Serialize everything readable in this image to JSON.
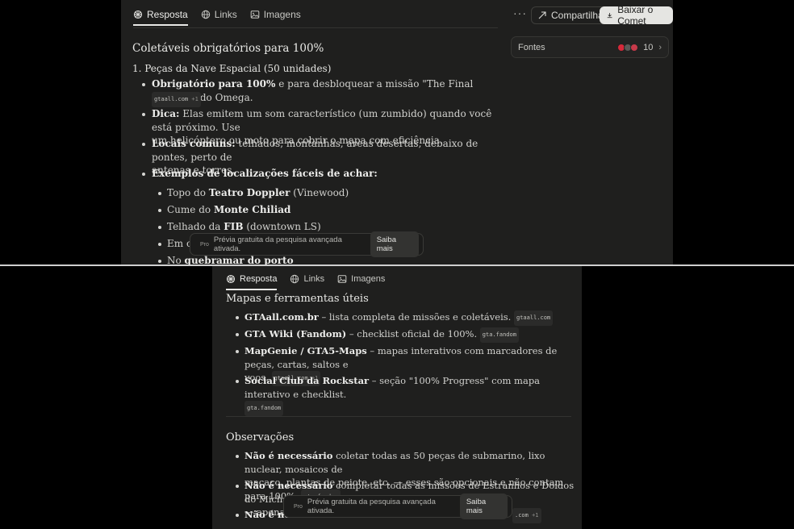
{
  "top": {
    "tabs": [
      {
        "label": "Resposta"
      },
      {
        "label": "Links"
      },
      {
        "label": "Imagens"
      }
    ],
    "menu": "···",
    "share_label": "Compartilhar",
    "download_label": "Baixar o Comet",
    "sources": {
      "label": "Fontes",
      "count": "10"
    },
    "heading": "Coletáveis obrigatórios para 100%",
    "section": "1. Peças da Nave Espacial (50 unidades)",
    "b1": {
      "strong": "Obrigatório para 100%",
      "text": " e para desbloquear a missão \"The Final Frontier\" do Omega."
    },
    "chip1": {
      "site": "gtaall.com",
      "plus": "+1"
    },
    "b2": {
      "strong": "Dica:",
      "line1": " Elas emitem um som característico (um zumbido) quando você está próximo. Use",
      "line2": "um helicóptero ou moto para cobrir o mapa com eficiência."
    },
    "b3": {
      "strong": "Locais comuns:",
      "line1": " telhados, montanhas, áreas desertas, debaixo de pontes, perto de",
      "line2": "antenas e torres."
    },
    "b4": {
      "strong": "Exemplos de localizações fáceis de achar:"
    },
    "sub1": {
      "pre": "Topo do ",
      "strong": "Teatro Doppler",
      "post": " (Vinewood)"
    },
    "sub2": {
      "pre": "Cume do ",
      "strong": "Monte Chiliad",
      "post": ""
    },
    "sub3": {
      "pre": "Telhado da ",
      "strong": "FIB",
      "post": " (downtown LS)"
    },
    "sub4": {
      "pre": "Em ci"
    },
    "sub5": {
      "pre": "No ",
      "strong": "quebramar do porto"
    },
    "toast": {
      "pro": "Pro",
      "text": "Prévia gratuita da pesquisa avançada ativada.",
      "button": "Saiba mais"
    }
  },
  "bottom": {
    "tabs": [
      {
        "label": "Resposta"
      },
      {
        "label": "Links"
      },
      {
        "label": "Imagens"
      }
    ],
    "heading": "Mapas e ferramentas úteis",
    "i1": {
      "strong": "GTAall.com.br",
      "text": " – lista completa de missões e coletáveis.",
      "chip": "gtaall.com"
    },
    "i2": {
      "strong": "GTA Wiki (Fandom)",
      "text": " – checklist oficial de 100%.",
      "chip": "gta.fandom"
    },
    "i3": {
      "strong": "MapGenie / GTA5-Maps",
      "line1": " – mapas interativos com marcadores de peças, cartas, saltos e",
      "line2": "voos.",
      "chip": "gtaall.com",
      "plus": "+1"
    },
    "i4": {
      "strong": "Social Club da Rockstar",
      "text": " – seção \"100% Progress\" com mapa interativo e checklist.",
      "chip": "gta.fandom"
    },
    "heading2": "Observações",
    "o1": {
      "strong": "Não é necessário",
      "line1": " coletar todas as 50 peças de submarino, lixo nuclear, mosaicos de",
      "line2": "macaco, plantas de peiote, etc. — esses são opcionais e não contam para 100%.",
      "chip": "gta.fandom"
    },
    "o2": {
      "strong": "Não é necessário",
      "line1": " completar todas as missões de Estranhos e Doidos do Michael e Trevor",
      "line2": "— apenas a"
    },
    "o3": {
      "strong": "Não é nece",
      "chip": ".com",
      "plus": "+1"
    },
    "toast": {
      "pro": "Pro",
      "text": "Prévia gratuita da pesquisa avançada ativada.",
      "button": "Saiba mais"
    }
  }
}
